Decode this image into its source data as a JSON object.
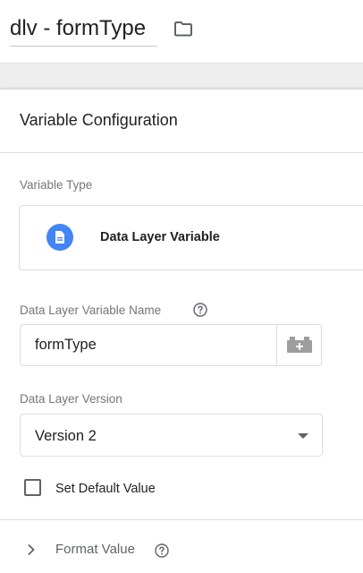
{
  "header": {
    "variable_name": "dlv - formType",
    "folder_icon": "folder-icon"
  },
  "config": {
    "title": "Variable Configuration",
    "variable_type_label": "Variable Type",
    "variable_type_value": "Data Layer Variable",
    "variable_type_icon": "document-icon",
    "variable_type_icon_color": "#4285f4",
    "dlv_name_label": "Data Layer Variable Name",
    "dlv_name_value": "formType",
    "dlv_version_label": "Data Layer Version",
    "dlv_version_value": "Version 2",
    "default_value_label": "Set Default Value",
    "default_value_checked": false,
    "format_value_label": "Format Value"
  }
}
